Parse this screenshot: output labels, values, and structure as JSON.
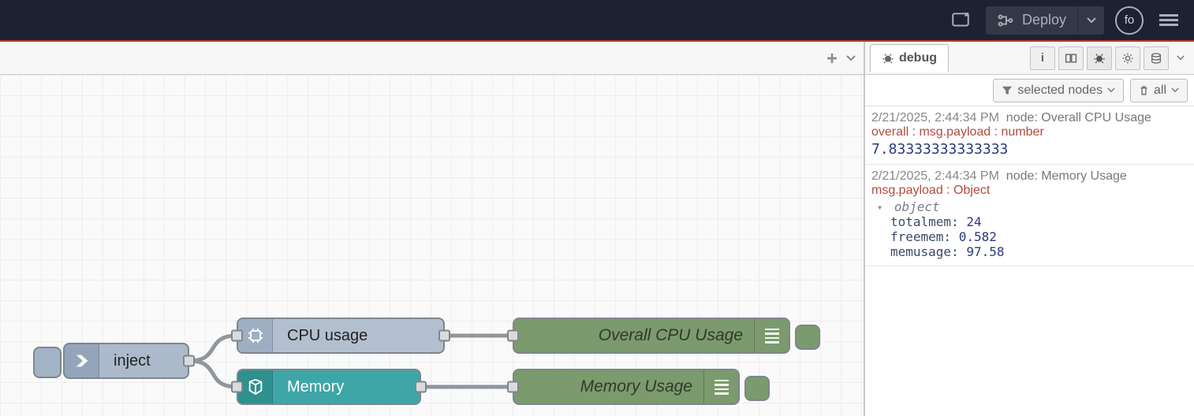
{
  "header": {
    "deploy_label": "Deploy",
    "user_initials": "fo"
  },
  "sidebar": {
    "tab_label": "debug",
    "filter_label": "selected nodes",
    "clear_label": "all"
  },
  "nodes": {
    "inject": {
      "label": "inject"
    },
    "cpu": {
      "label": "CPU usage"
    },
    "mem": {
      "label": "Memory"
    },
    "dbg1": {
      "label": "Overall CPU Usage"
    },
    "dbg2": {
      "label": "Memory Usage"
    }
  },
  "debug_messages": [
    {
      "timestamp": "2/21/2025, 2:44:34 PM",
      "node_label": "node: Overall CPU Usage",
      "topic": "overall : msg.payload : number",
      "value": "7.83333333333333"
    },
    {
      "timestamp": "2/21/2025, 2:44:34 PM",
      "node_label": "node: Memory Usage",
      "topic": "msg.payload : Object",
      "object_label": "object",
      "props": {
        "totalmem": "24",
        "freemem": "0.582",
        "memusage": "97.58"
      }
    }
  ]
}
